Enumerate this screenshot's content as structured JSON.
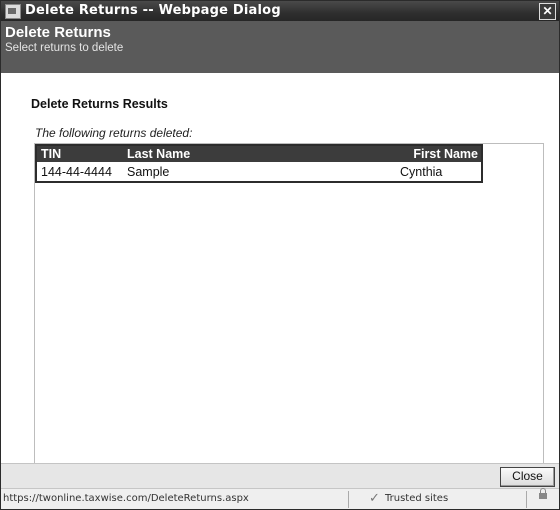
{
  "window": {
    "title": "Delete Returns -- Webpage Dialog",
    "close_glyph": "✕"
  },
  "header": {
    "title": "Delete Returns",
    "subtitle": "Select returns to delete"
  },
  "content": {
    "section_title": "Delete Returns Results",
    "note": "The following returns deleted:",
    "table": {
      "columns": [
        "TIN",
        "Last Name",
        "First Name"
      ],
      "rows": [
        [
          "144-44-4444",
          "Sample",
          "Cynthia"
        ]
      ]
    }
  },
  "buttons": {
    "close_label": "Close"
  },
  "statusbar": {
    "url": "https://twonline.taxwise.com/DeleteReturns.aspx",
    "zone": "Trusted sites",
    "zone_icon": "checkmark-icon",
    "lock_icon": "lock-icon"
  }
}
